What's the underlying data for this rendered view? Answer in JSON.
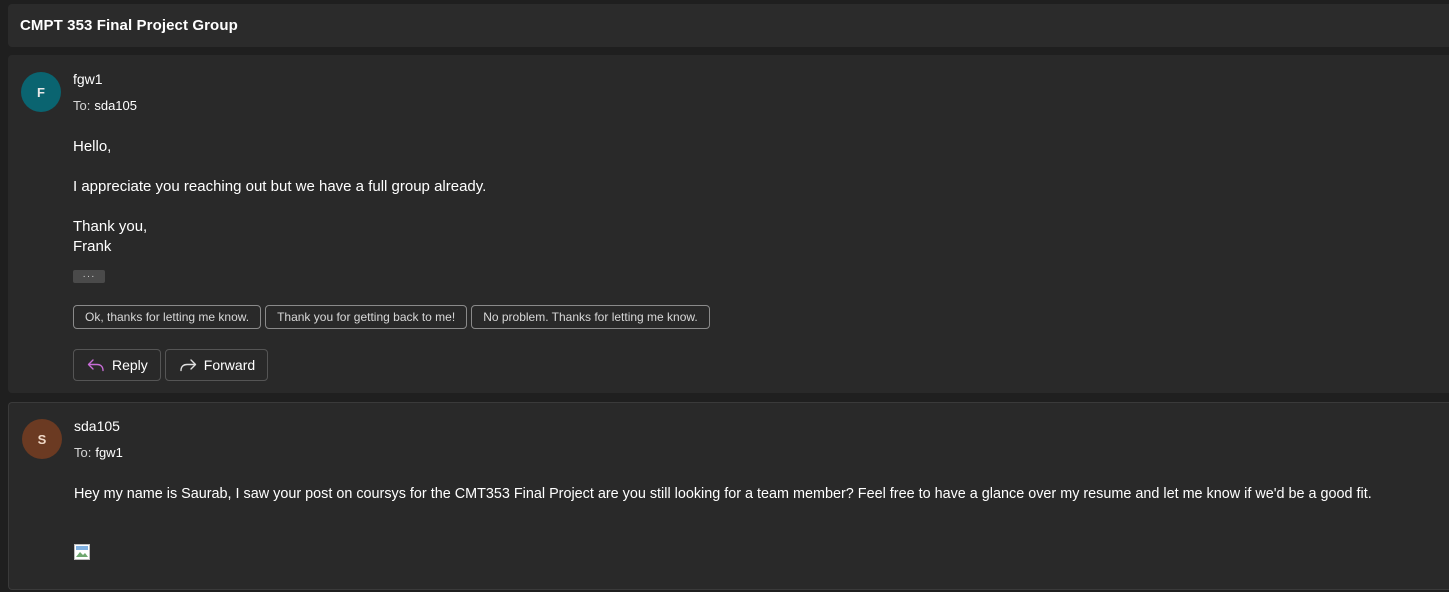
{
  "thread": {
    "subject": "CMPT 353 Final  Project Group"
  },
  "message1": {
    "avatar_initial": "F",
    "sender": "fgw1",
    "to_label": "To:",
    "to_value": "sda105",
    "greeting": "Hello,",
    "body": "I appreciate you reaching out but we have a full group already.",
    "signoff": "Thank you,",
    "signature": "Frank",
    "more_label": "···",
    "suggestions": [
      "Ok, thanks for letting me know.",
      "Thank you for getting back to me!",
      "No problem. Thanks for letting me know."
    ],
    "reply_label": "Reply",
    "forward_label": "Forward"
  },
  "message2": {
    "avatar_initial": "S",
    "sender": "sda105",
    "to_label": "To:",
    "to_value": "fgw1",
    "body": "Hey my name is Saurab, I saw your post on coursys for the CMT353 Final Project are you still looking for a team member? Feel free to have a glance over my resume and let me know if we'd be a good fit."
  },
  "colors": {
    "background": "#1f1f1f",
    "card": "#292929",
    "avatar_f": "#0a6470",
    "avatar_s": "#6b3a22",
    "reply_icon": "#c86dd7"
  }
}
